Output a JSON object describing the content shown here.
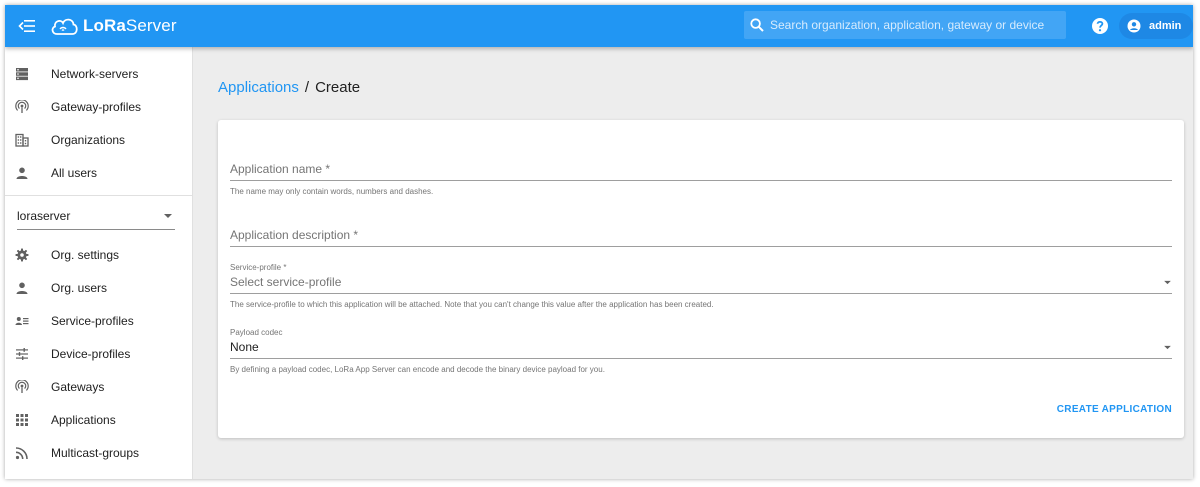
{
  "topbar": {
    "brand_prefix": "LoRa",
    "brand_suffix": "Server",
    "search_placeholder": "Search organization, application, gateway or device",
    "user_name": "admin",
    "background_color": "#2196f3"
  },
  "sidebar": {
    "top_items": [
      {
        "label": "Network-servers",
        "icon": "server-icon"
      },
      {
        "label": "Gateway-profiles",
        "icon": "gateway-icon"
      },
      {
        "label": "Organizations",
        "icon": "domain-icon"
      },
      {
        "label": "All users",
        "icon": "person-icon"
      }
    ],
    "org_select_value": "loraserver",
    "org_items": [
      {
        "label": "Org. settings",
        "icon": "gear-icon"
      },
      {
        "label": "Org. users",
        "icon": "person-icon"
      },
      {
        "label": "Service-profiles",
        "icon": "account-details-icon"
      },
      {
        "label": "Device-profiles",
        "icon": "tune-icon"
      },
      {
        "label": "Gateways",
        "icon": "gateway-icon"
      },
      {
        "label": "Applications",
        "icon": "apps-grid-icon"
      },
      {
        "label": "Multicast-groups",
        "icon": "rss-icon"
      }
    ]
  },
  "breadcrumb": {
    "parent": "Applications",
    "separator": "/",
    "current": "Create"
  },
  "form": {
    "name_placeholder": "Application name *",
    "name_helper": "The name may only contain words, numbers and dashes.",
    "description_placeholder": "Application description *",
    "service_profile_label": "Service-profile *",
    "service_profile_placeholder": "Select service-profile",
    "service_profile_helper": "The service-profile to which this application will be attached. Note that you can't change this value after the application has been created.",
    "codec_label": "Payload codec",
    "codec_value": "None",
    "codec_helper": "By defining a payload codec, LoRa App Server can encode and decode the binary device payload for you.",
    "submit_label": "CREATE APPLICATION"
  }
}
